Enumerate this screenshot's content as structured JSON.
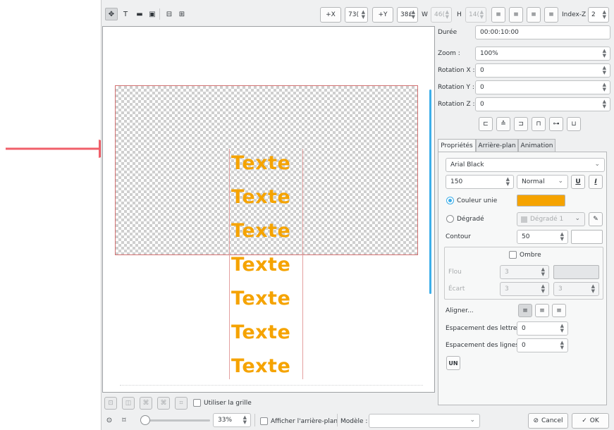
{
  "toolbar": {
    "plus_x": "+X",
    "x_value": "73(",
    "plus_y": "+Y",
    "y_value": "38£",
    "w_label": "W",
    "w_value": "46(",
    "h_label": "H",
    "h_value": "14(",
    "index_z_label": "Index-Z",
    "index_z_value": "2"
  },
  "properties": {
    "duree_label": "Durée",
    "duree_value": "00:00:10:00",
    "zoom_label": "Zoom :",
    "zoom_value": "100%",
    "rotx_label": "Rotation X :",
    "rotx_value": "0",
    "roty_label": "Rotation Y :",
    "roty_value": "0",
    "rotz_label": "Rotation Z :",
    "rotz_value": "0"
  },
  "tabs": [
    "Propriétés",
    "Arrière-plan",
    "Animation"
  ],
  "text_props": {
    "font": "Arial Black",
    "size": "150",
    "weight": "Normal",
    "underline": "U",
    "italic": "I",
    "solid_color_label": "Couleur unie",
    "solid_color": "#f5a300",
    "gradient_label": "Dégradé",
    "gradient_value": "Dégradé 1",
    "outline_label": "Contour",
    "outline_value": "50",
    "shadow_label": "Ombre",
    "blur_label": "Flou",
    "blur_value": "3",
    "spacing_label": "Écart",
    "spacing_x": "3",
    "spacing_y": "3",
    "align_label": "Aligner...",
    "letter_spacing_label": "Espacement des lettres",
    "letter_spacing_value": "0",
    "line_spacing_label": "Espacement des lignes",
    "line_spacing_value": "0",
    "un_label": "UN"
  },
  "canvas": {
    "lines": [
      "Texte",
      "Texte",
      "Texte",
      "Texte",
      "Texte",
      "Texte",
      "Texte"
    ],
    "text_color": "#f5a300"
  },
  "bottom": {
    "use_grid_label": "Utiliser la grille",
    "zoom_value": "33%",
    "show_background_label": "Afficher l'arrière-plan",
    "template_label": "Modèle :",
    "template_value": "",
    "cancel_label": "Cancel",
    "ok_label": "OK"
  },
  "annotation": {
    "arrow_color": "#f0606a"
  }
}
